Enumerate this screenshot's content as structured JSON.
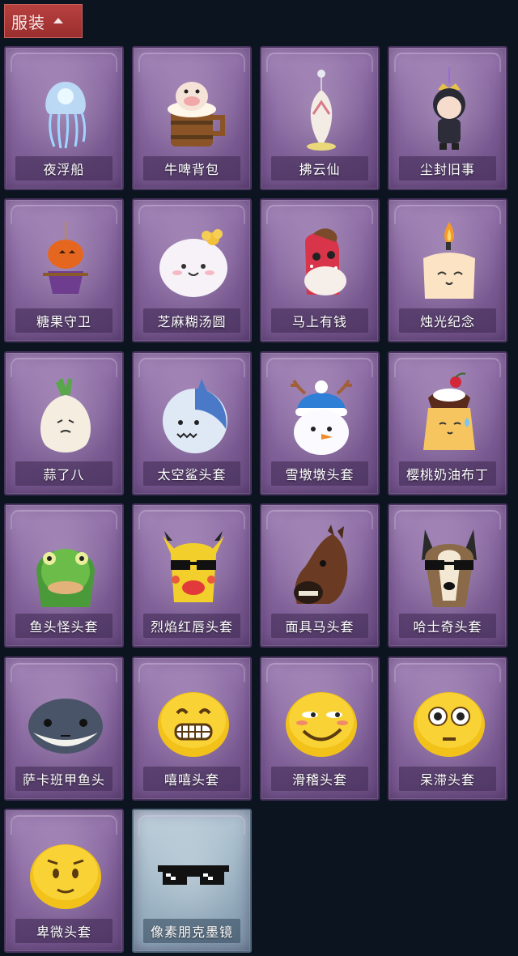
{
  "section": {
    "title": "服装"
  },
  "items": [
    {
      "name": "夜浮船",
      "icon": "jellyfish-pendant-icon",
      "rarity": "purple"
    },
    {
      "name": "牛啤背包",
      "icon": "cow-beer-mug-icon",
      "rarity": "purple"
    },
    {
      "name": "拂云仙",
      "icon": "fox-immortal-pendant-icon",
      "rarity": "purple"
    },
    {
      "name": "尘封旧事",
      "icon": "chibi-prince-pendant-icon",
      "rarity": "purple"
    },
    {
      "name": "糖果守卫",
      "icon": "pumpkin-scarecrow-icon",
      "rarity": "purple"
    },
    {
      "name": "芝麻糊汤圆",
      "icon": "rice-ball-flower-icon",
      "rarity": "purple"
    },
    {
      "name": "马上有钱",
      "icon": "red-horse-head-icon",
      "rarity": "purple"
    },
    {
      "name": "烛光纪念",
      "icon": "candle-head-icon",
      "rarity": "purple"
    },
    {
      "name": "蒜了八",
      "icon": "garlic-head-icon",
      "rarity": "purple"
    },
    {
      "name": "太空鲨头套",
      "icon": "space-shark-helmet-icon",
      "rarity": "purple"
    },
    {
      "name": "雪墩墩头套",
      "icon": "snowman-helmet-icon",
      "rarity": "purple"
    },
    {
      "name": "樱桃奶油布丁",
      "icon": "cherry-pudding-icon",
      "rarity": "purple"
    },
    {
      "name": "鱼头怪头套",
      "icon": "fish-head-mask-icon",
      "rarity": "purple"
    },
    {
      "name": "烈焰红唇头套",
      "icon": "red-lips-mask-icon",
      "rarity": "purple"
    },
    {
      "name": "面具马头套",
      "icon": "horse-mask-icon",
      "rarity": "purple"
    },
    {
      "name": "哈士奇头套",
      "icon": "husky-mask-icon",
      "rarity": "purple"
    },
    {
      "name": "萨卡班甲鱼头",
      "icon": "sacabambaspis-head-icon",
      "rarity": "purple"
    },
    {
      "name": "嘻嘻头套",
      "icon": "grin-emoji-icon",
      "rarity": "purple"
    },
    {
      "name": "滑稽头套",
      "icon": "funny-emoji-icon",
      "rarity": "purple"
    },
    {
      "name": "呆滞头套",
      "icon": "dazed-emoji-icon",
      "rarity": "purple"
    },
    {
      "name": "卑微头套",
      "icon": "humble-emoji-icon",
      "rarity": "purple"
    },
    {
      "name": "像素朋克墨镜",
      "icon": "pixel-sunglasses-icon",
      "rarity": "blue"
    }
  ],
  "colors": {
    "background": "#0c1420",
    "header": "#a8353a",
    "card_purple": "#8f6ea6",
    "card_blue": "#a6bccb"
  }
}
